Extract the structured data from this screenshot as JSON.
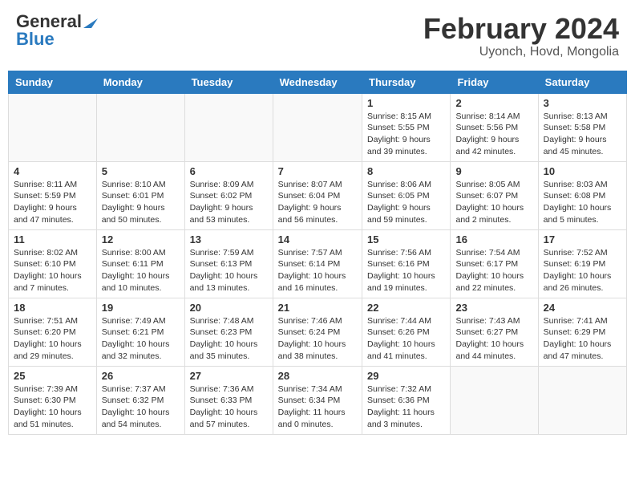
{
  "header": {
    "logo_general": "General",
    "logo_blue": "Blue",
    "main_title": "February 2024",
    "subtitle": "Uyonch, Hovd, Mongolia"
  },
  "days_of_week": [
    "Sunday",
    "Monday",
    "Tuesday",
    "Wednesday",
    "Thursday",
    "Friday",
    "Saturday"
  ],
  "weeks": [
    [
      {
        "day": "",
        "info": ""
      },
      {
        "day": "",
        "info": ""
      },
      {
        "day": "",
        "info": ""
      },
      {
        "day": "",
        "info": ""
      },
      {
        "day": "1",
        "info": "Sunrise: 8:15 AM\nSunset: 5:55 PM\nDaylight: 9 hours\nand 39 minutes."
      },
      {
        "day": "2",
        "info": "Sunrise: 8:14 AM\nSunset: 5:56 PM\nDaylight: 9 hours\nand 42 minutes."
      },
      {
        "day": "3",
        "info": "Sunrise: 8:13 AM\nSunset: 5:58 PM\nDaylight: 9 hours\nand 45 minutes."
      }
    ],
    [
      {
        "day": "4",
        "info": "Sunrise: 8:11 AM\nSunset: 5:59 PM\nDaylight: 9 hours\nand 47 minutes."
      },
      {
        "day": "5",
        "info": "Sunrise: 8:10 AM\nSunset: 6:01 PM\nDaylight: 9 hours\nand 50 minutes."
      },
      {
        "day": "6",
        "info": "Sunrise: 8:09 AM\nSunset: 6:02 PM\nDaylight: 9 hours\nand 53 minutes."
      },
      {
        "day": "7",
        "info": "Sunrise: 8:07 AM\nSunset: 6:04 PM\nDaylight: 9 hours\nand 56 minutes."
      },
      {
        "day": "8",
        "info": "Sunrise: 8:06 AM\nSunset: 6:05 PM\nDaylight: 9 hours\nand 59 minutes."
      },
      {
        "day": "9",
        "info": "Sunrise: 8:05 AM\nSunset: 6:07 PM\nDaylight: 10 hours\nand 2 minutes."
      },
      {
        "day": "10",
        "info": "Sunrise: 8:03 AM\nSunset: 6:08 PM\nDaylight: 10 hours\nand 5 minutes."
      }
    ],
    [
      {
        "day": "11",
        "info": "Sunrise: 8:02 AM\nSunset: 6:10 PM\nDaylight: 10 hours\nand 7 minutes."
      },
      {
        "day": "12",
        "info": "Sunrise: 8:00 AM\nSunset: 6:11 PM\nDaylight: 10 hours\nand 10 minutes."
      },
      {
        "day": "13",
        "info": "Sunrise: 7:59 AM\nSunset: 6:13 PM\nDaylight: 10 hours\nand 13 minutes."
      },
      {
        "day": "14",
        "info": "Sunrise: 7:57 AM\nSunset: 6:14 PM\nDaylight: 10 hours\nand 16 minutes."
      },
      {
        "day": "15",
        "info": "Sunrise: 7:56 AM\nSunset: 6:16 PM\nDaylight: 10 hours\nand 19 minutes."
      },
      {
        "day": "16",
        "info": "Sunrise: 7:54 AM\nSunset: 6:17 PM\nDaylight: 10 hours\nand 22 minutes."
      },
      {
        "day": "17",
        "info": "Sunrise: 7:52 AM\nSunset: 6:19 PM\nDaylight: 10 hours\nand 26 minutes."
      }
    ],
    [
      {
        "day": "18",
        "info": "Sunrise: 7:51 AM\nSunset: 6:20 PM\nDaylight: 10 hours\nand 29 minutes."
      },
      {
        "day": "19",
        "info": "Sunrise: 7:49 AM\nSunset: 6:21 PM\nDaylight: 10 hours\nand 32 minutes."
      },
      {
        "day": "20",
        "info": "Sunrise: 7:48 AM\nSunset: 6:23 PM\nDaylight: 10 hours\nand 35 minutes."
      },
      {
        "day": "21",
        "info": "Sunrise: 7:46 AM\nSunset: 6:24 PM\nDaylight: 10 hours\nand 38 minutes."
      },
      {
        "day": "22",
        "info": "Sunrise: 7:44 AM\nSunset: 6:26 PM\nDaylight: 10 hours\nand 41 minutes."
      },
      {
        "day": "23",
        "info": "Sunrise: 7:43 AM\nSunset: 6:27 PM\nDaylight: 10 hours\nand 44 minutes."
      },
      {
        "day": "24",
        "info": "Sunrise: 7:41 AM\nSunset: 6:29 PM\nDaylight: 10 hours\nand 47 minutes."
      }
    ],
    [
      {
        "day": "25",
        "info": "Sunrise: 7:39 AM\nSunset: 6:30 PM\nDaylight: 10 hours\nand 51 minutes."
      },
      {
        "day": "26",
        "info": "Sunrise: 7:37 AM\nSunset: 6:32 PM\nDaylight: 10 hours\nand 54 minutes."
      },
      {
        "day": "27",
        "info": "Sunrise: 7:36 AM\nSunset: 6:33 PM\nDaylight: 10 hours\nand 57 minutes."
      },
      {
        "day": "28",
        "info": "Sunrise: 7:34 AM\nSunset: 6:34 PM\nDaylight: 11 hours\nand 0 minutes."
      },
      {
        "day": "29",
        "info": "Sunrise: 7:32 AM\nSunset: 6:36 PM\nDaylight: 11 hours\nand 3 minutes."
      },
      {
        "day": "",
        "info": ""
      },
      {
        "day": "",
        "info": ""
      }
    ]
  ]
}
